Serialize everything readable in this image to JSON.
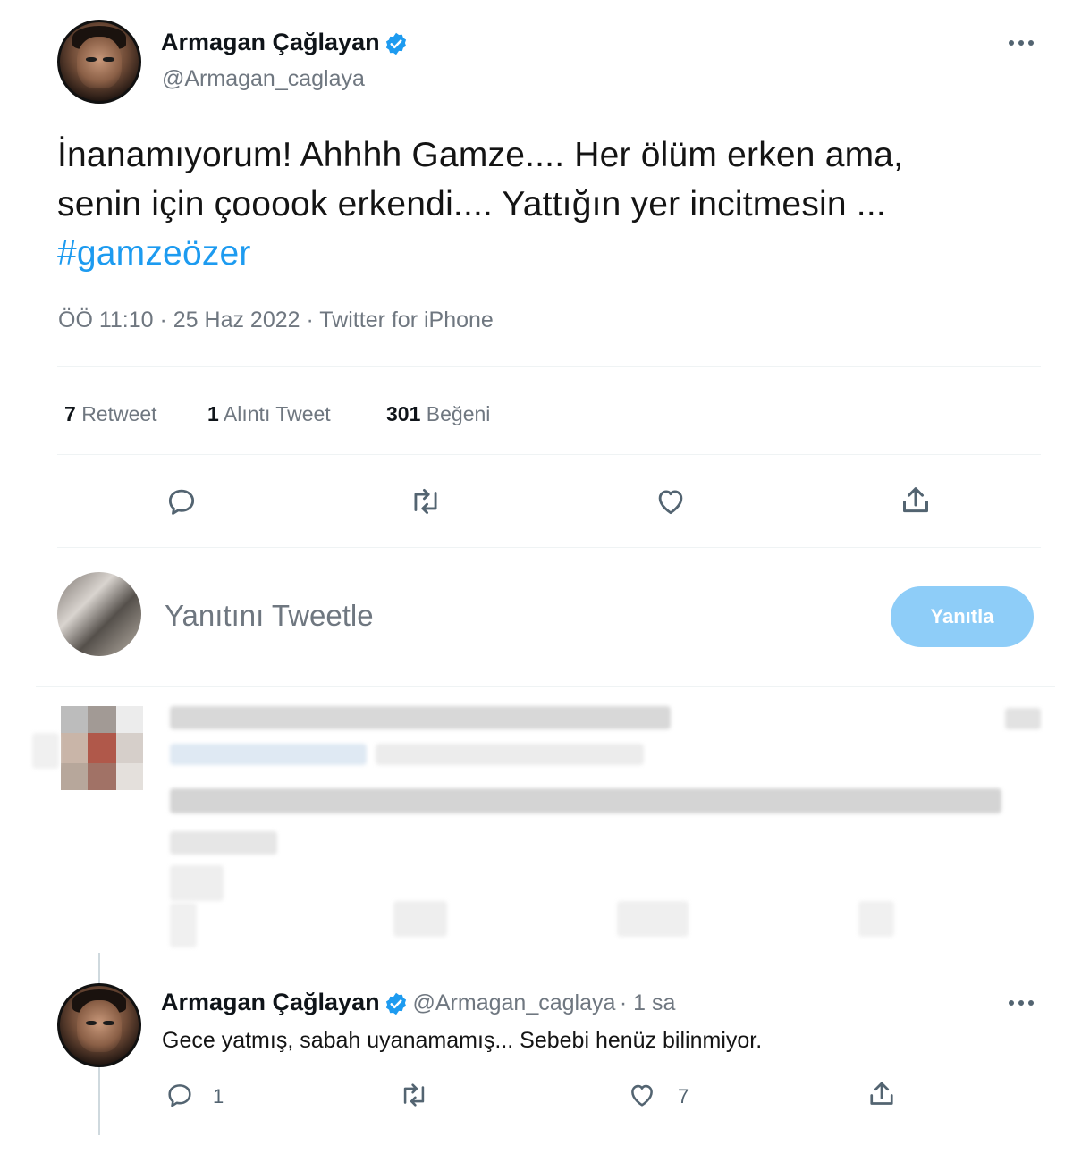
{
  "main_tweet": {
    "author_name": "Armagan Çağlayan",
    "author_handle": "@Armagan_caglaya",
    "text_line1": "İnanamıyorum! Ahhhh Gamze.... Her ölüm erken ama,",
    "text_line2": "senin için çooook erkendi.... Yattığın yer incitmesin ...",
    "hashtag": "#gamzeözer",
    "timestamp": "ÖÖ 11:10 · 25 Haz 2022 · Twitter for iPhone",
    "stats": {
      "retweet_count": "7",
      "retweet_label": "Retweet",
      "quote_count": "1",
      "quote_label": "Alıntı Tweet",
      "like_count": "301",
      "like_label": "Beğeni"
    }
  },
  "composer": {
    "placeholder": "Yanıtını Tweetle",
    "reply_button": "Yanıtla"
  },
  "reply_tweet": {
    "author_name": "Armagan Çağlayan",
    "author_handle": "@Armagan_caglaya",
    "time_ago": "· 1 sa",
    "text": "Gece yatmış, sabah uyanamamış... Sebebi henüz bilinmiyor.",
    "reply_count": "1",
    "like_count": "7"
  },
  "icons": {
    "more": "more-icon",
    "reply": "reply-icon",
    "retweet": "retweet-icon",
    "like": "heart-icon",
    "share": "share-icon",
    "verified": "verified-badge-icon"
  },
  "colors": {
    "accent": "#1d9bf0",
    "reply_button_disabled": "#8ecdf8",
    "secondary_text": "#6f7780"
  }
}
